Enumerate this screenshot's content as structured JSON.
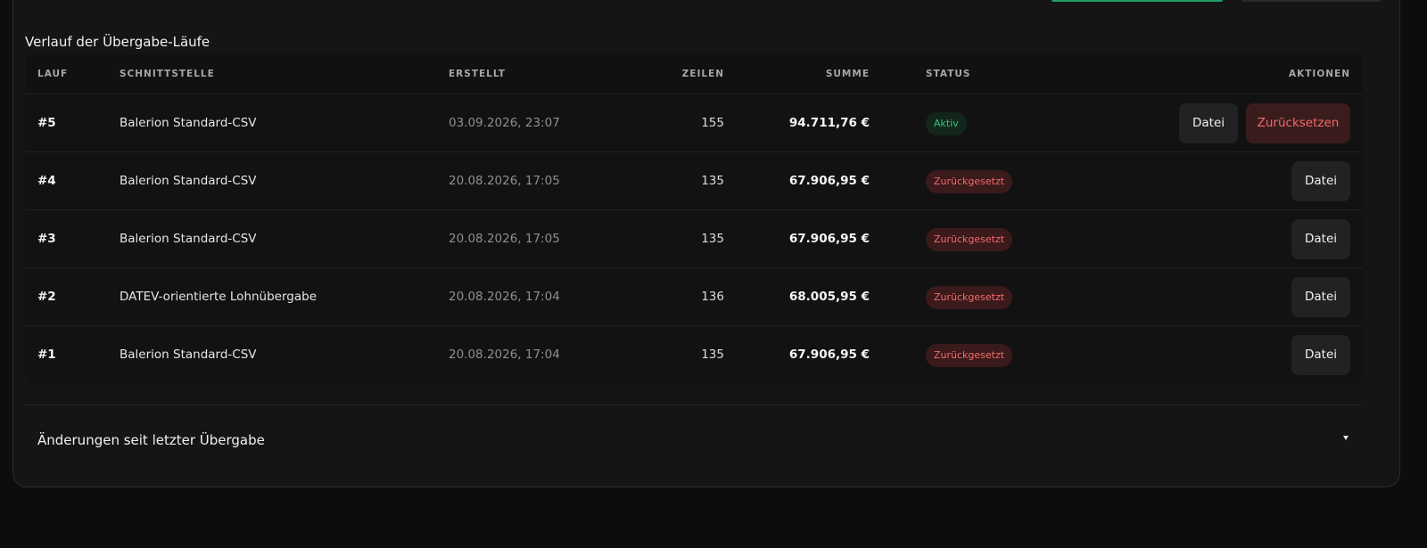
{
  "section": {
    "title": "Verlauf der Übergabe-Läufe"
  },
  "table": {
    "headers": {
      "lauf": "LAUF",
      "schnittstelle": "SCHNITTSTELLE",
      "erstellt": "ERSTELLT",
      "zeilen": "ZEILEN",
      "summe": "SUMME",
      "status": "STATUS",
      "aktionen": "AKTIONEN"
    },
    "rows": [
      {
        "lauf": "#5",
        "schnittstelle": "Balerion Standard-CSV",
        "erstellt": "03.09.2026, 23:07",
        "zeilen": "155",
        "summe": "94.711,76 €",
        "status": "Aktiv",
        "file_label": "Datei",
        "reset_label": "Zurücksetzen"
      },
      {
        "lauf": "#4",
        "schnittstelle": "Balerion Standard-CSV",
        "erstellt": "20.08.2026, 17:05",
        "zeilen": "135",
        "summe": "67.906,95 €",
        "status": "Zurückgesetzt",
        "file_label": "Datei"
      },
      {
        "lauf": "#3",
        "schnittstelle": "Balerion Standard-CSV",
        "erstellt": "20.08.2026, 17:05",
        "zeilen": "135",
        "summe": "67.906,95 €",
        "status": "Zurückgesetzt",
        "file_label": "Datei"
      },
      {
        "lauf": "#2",
        "schnittstelle": "DATEV-orientierte Lohnübergabe",
        "erstellt": "20.08.2026, 17:04",
        "zeilen": "136",
        "summe": "68.005,95 €",
        "status": "Zurückgesetzt",
        "file_label": "Datei"
      },
      {
        "lauf": "#1",
        "schnittstelle": "Balerion Standard-CSV",
        "erstellt": "20.08.2026, 17:04",
        "zeilen": "135",
        "summe": "67.906,95 €",
        "status": "Zurückgesetzt",
        "file_label": "Datei"
      }
    ]
  },
  "changes": {
    "title": "Änderungen seit letzter Übergabe",
    "icon": "chevron-down-icon"
  },
  "colors": {
    "active_badge": "#35c27c",
    "reset_badge": "#f36b6b",
    "accent_green": "#1e9e62"
  }
}
